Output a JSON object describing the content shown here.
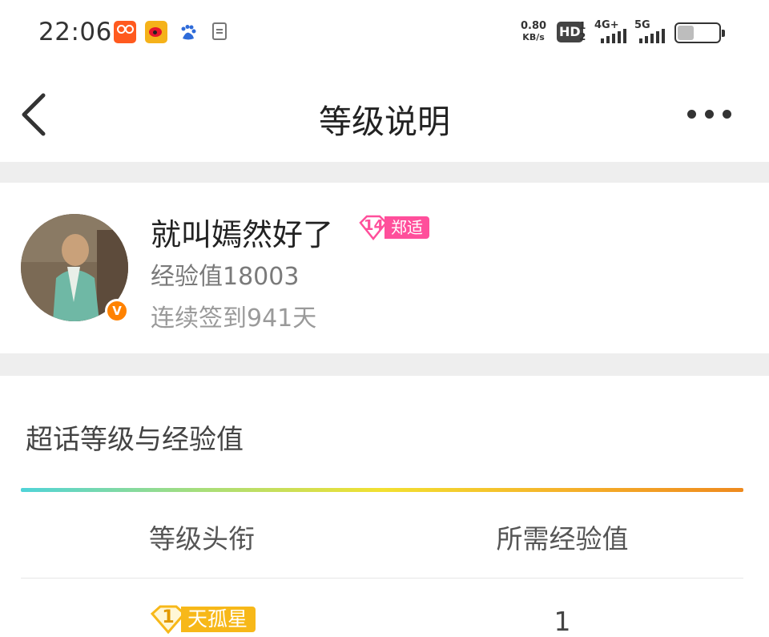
{
  "status_bar": {
    "time": "22:06",
    "net_speed_value": "0.80",
    "net_speed_unit": "KB/s",
    "hd_label": "HD",
    "hd_sim_top": "1",
    "hd_sim_bottom": "2",
    "network_1": "4G+",
    "network_2": "5G",
    "apps": [
      "kuaishou-icon",
      "weibo-icon",
      "baidu-icon",
      "document-icon"
    ]
  },
  "nav": {
    "title": "等级说明",
    "back_icon": "chevron-left-icon",
    "more_icon": "more-dots-icon"
  },
  "profile": {
    "username": "就叫嫣然好了",
    "level_number": "14",
    "level_name": "郑适",
    "verified_badge": "V",
    "experience": "经验值18003",
    "checkin": "连续签到941天"
  },
  "section": {
    "title": "超话等级与经验值",
    "columns": [
      "等级头衔",
      "所需经验值"
    ],
    "rows": [
      {
        "level": "1",
        "title": "天孤星",
        "required_exp": "1"
      }
    ]
  },
  "colors": {
    "level_badge": "#ff4f9b",
    "rank_badge": "#f7b819",
    "verified": "#ff8200",
    "divider_gradient": [
      "#4fd3d8",
      "#f2e030",
      "#ee8a1e"
    ]
  }
}
